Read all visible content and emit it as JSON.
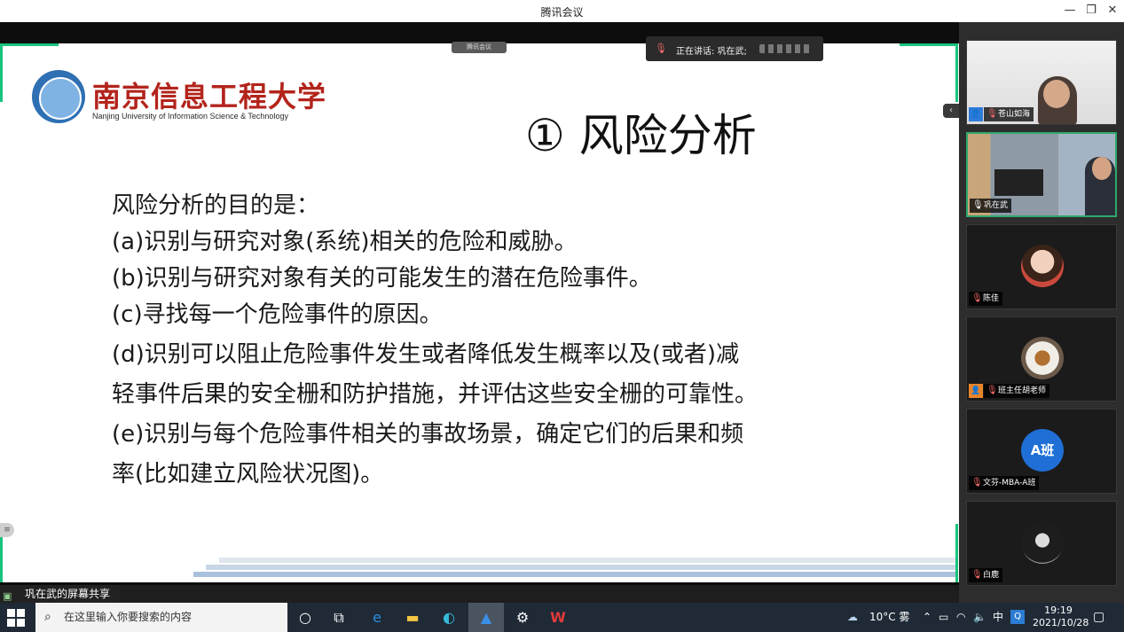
{
  "window": {
    "title": "腾讯会议"
  },
  "window_controls": {
    "minimize": "—",
    "restore": "❐",
    "close": "✕"
  },
  "meeting": {
    "zoom_chip": "腾讯会议",
    "speaking_label": "正在讲话: 巩在武;",
    "share_label": "巩在武的屏幕共享"
  },
  "slide": {
    "logo_name": "南京信息工程大学",
    "logo_sub": "Nanjing University of Information Science & Technology",
    "title": "① 风险分析",
    "lines": [
      "风险分析的目的是：",
      "(a)识别与研究对象(系统)相关的危险和威胁。",
      "(b)识别与研究对象有关的可能发生的潜在危险事件。",
      "(c)寻找每一个危险事件的原因。",
      "(d)识别可以阻止危险事件发生或者降低发生概率以及(或者)减",
      "轻事件后果的安全栅和防护措施，并评估这些安全栅的可靠性。",
      "(e)识别与每个危险事件相关的事故场景，确定它们的后果和频",
      "率(比如建立风险状况图)。"
    ]
  },
  "participants": [
    {
      "name": "苍山如海",
      "kind": "video",
      "badge": "user"
    },
    {
      "name": "巩在武",
      "kind": "video",
      "active": true
    },
    {
      "name": "陈佳",
      "kind": "avatar"
    },
    {
      "name": "班主任胡老师",
      "kind": "avatar",
      "badge": "user-orange"
    },
    {
      "name": "文芬-MBA-A班",
      "kind": "text-avatar",
      "avatar_text": "A班"
    },
    {
      "name": "白鹿",
      "kind": "avatar"
    }
  ],
  "taskbar": {
    "search_placeholder": "在这里输入你要搜索的内容",
    "weather": "10°C 雾",
    "ime": "中",
    "time": "19:19",
    "date": "2021/10/28"
  },
  "colors": {
    "accent_green": "#19c37d",
    "logo_red": "#b3241c",
    "tencent_blue": "#1f6fd6"
  }
}
